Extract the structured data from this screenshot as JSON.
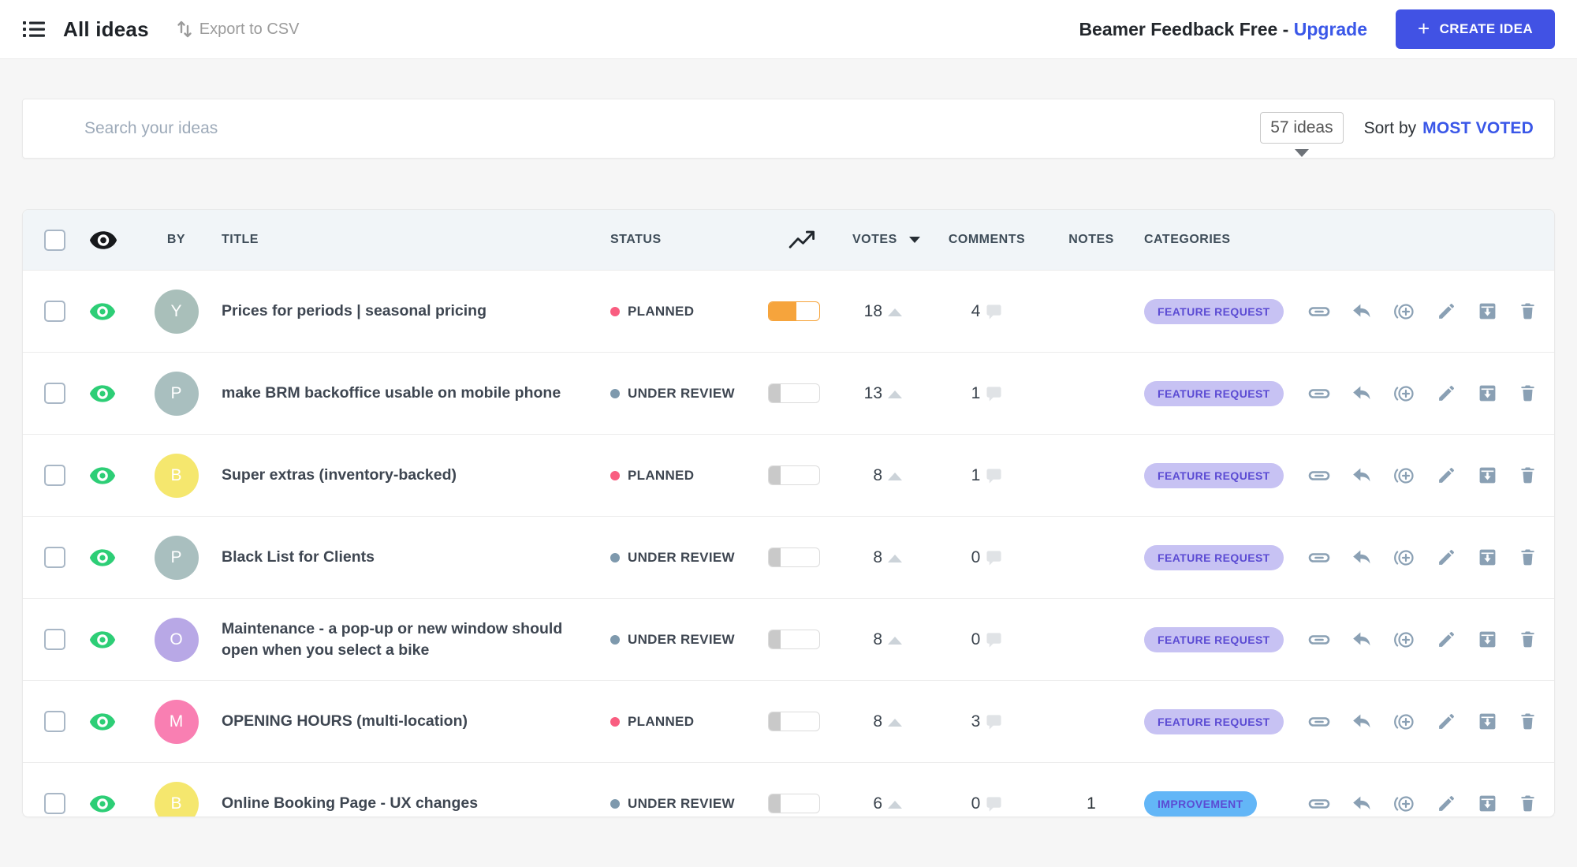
{
  "topbar": {
    "title": "All ideas",
    "export_label": "Export to CSV",
    "plan_label": "Beamer Feedback Free -",
    "upgrade_label": "Upgrade",
    "create_plus": "+",
    "create_label": "CREATE IDEA"
  },
  "search": {
    "placeholder": "Search your ideas",
    "count": "57 ideas",
    "sort_prefix": "Sort by",
    "sort_value": "MOST VOTED"
  },
  "icons": {
    "topbar_left": "list-icon",
    "export": "sort-arrows-icon",
    "header_visibility": "eye-icon",
    "header_trend": "trending-up-icon",
    "row_visibility": "eye-icon",
    "comments": "comment-bubble-icon",
    "actions": [
      "copy-link-icon",
      "reply-icon",
      "circle-plus-icon",
      "edit-pencil-icon",
      "archive-icon",
      "trash-icon"
    ]
  },
  "colors": {
    "accent_blue": "#4152e4",
    "link_blue": "#3a57e8",
    "eye_green": "#2dce76",
    "icon_slate": "#8aa0b4",
    "header_bg": "#f1f5f8",
    "planned_dot": "#f95d80",
    "under_review_dot": "#7e99ad"
  },
  "table": {
    "headers": {
      "by": "BY",
      "title": "TITLE",
      "status": "STATUS",
      "votes": "VOTES",
      "comments": "COMMENTS",
      "notes": "NOTES",
      "categories": "CATEGORIES"
    },
    "rows": [
      {
        "avatar": "Y",
        "avatar_bg": "#a9bfba",
        "title": "Prices for periods | seasonal pricing",
        "status": "PLANNED",
        "status_color": "#f95d80",
        "progress": {
          "pct": 55,
          "fill": "#f6a43c",
          "border": "#f6a43c"
        },
        "votes": "18",
        "comments": "4",
        "notes": "",
        "category": {
          "label": "FEATURE REQUEST",
          "bg": "#c7c2f3",
          "fg": "#5b4bd3"
        }
      },
      {
        "avatar": "P",
        "avatar_bg": "#a9bfbf",
        "title": "make BRM backoffice usable on mobile phone",
        "status": "UNDER REVIEW",
        "status_color": "#7e99ad",
        "progress": {
          "pct": 24,
          "fill": "#c9c9c9",
          "border": "#dcdcdc"
        },
        "votes": "13",
        "comments": "1",
        "notes": "",
        "category": {
          "label": "FEATURE REQUEST",
          "bg": "#c7c2f3",
          "fg": "#5b4bd3"
        }
      },
      {
        "avatar": "B",
        "avatar_bg": "#f5e76e",
        "title": "Super extras (inventory-backed)",
        "status": "PLANNED",
        "status_color": "#f95d80",
        "progress": {
          "pct": 24,
          "fill": "#c9c9c9",
          "border": "#dcdcdc"
        },
        "votes": "8",
        "comments": "1",
        "notes": "",
        "category": {
          "label": "FEATURE REQUEST",
          "bg": "#c7c2f3",
          "fg": "#5b4bd3"
        }
      },
      {
        "avatar": "P",
        "avatar_bg": "#a9bfbf",
        "title": "Black List for Clients",
        "status": "UNDER REVIEW",
        "status_color": "#7e99ad",
        "progress": {
          "pct": 24,
          "fill": "#c9c9c9",
          "border": "#dcdcdc"
        },
        "votes": "8",
        "comments": "0",
        "notes": "",
        "category": {
          "label": "FEATURE REQUEST",
          "bg": "#c7c2f3",
          "fg": "#5b4bd3"
        }
      },
      {
        "avatar": "O",
        "avatar_bg": "#b8a8e6",
        "title": "Maintenance - a pop-up or new window should open when you select a bike",
        "status": "UNDER REVIEW",
        "status_color": "#7e99ad",
        "progress": {
          "pct": 24,
          "fill": "#c9c9c9",
          "border": "#dcdcdc"
        },
        "votes": "8",
        "comments": "0",
        "notes": "",
        "category": {
          "label": "FEATURE REQUEST",
          "bg": "#c7c2f3",
          "fg": "#5b4bd3"
        }
      },
      {
        "avatar": "M",
        "avatar_bg": "#f97fb2",
        "title": "OPENING HOURS (multi-location)",
        "status": "PLANNED",
        "status_color": "#f95d80",
        "progress": {
          "pct": 24,
          "fill": "#c9c9c9",
          "border": "#dcdcdc"
        },
        "votes": "8",
        "comments": "3",
        "notes": "",
        "category": {
          "label": "FEATURE REQUEST",
          "bg": "#c7c2f3",
          "fg": "#5b4bd3"
        }
      },
      {
        "avatar": "B",
        "avatar_bg": "#f5e76e",
        "title": "Online Booking Page - UX changes",
        "status": "UNDER REVIEW",
        "status_color": "#7e99ad",
        "progress": {
          "pct": 24,
          "fill": "#c9c9c9",
          "border": "#dcdcdc"
        },
        "votes": "6",
        "comments": "0",
        "notes": "1",
        "category": {
          "label": "IMPROVEMENT",
          "bg": "#63b6f7",
          "fg": "#5b4bd3"
        }
      }
    ]
  }
}
